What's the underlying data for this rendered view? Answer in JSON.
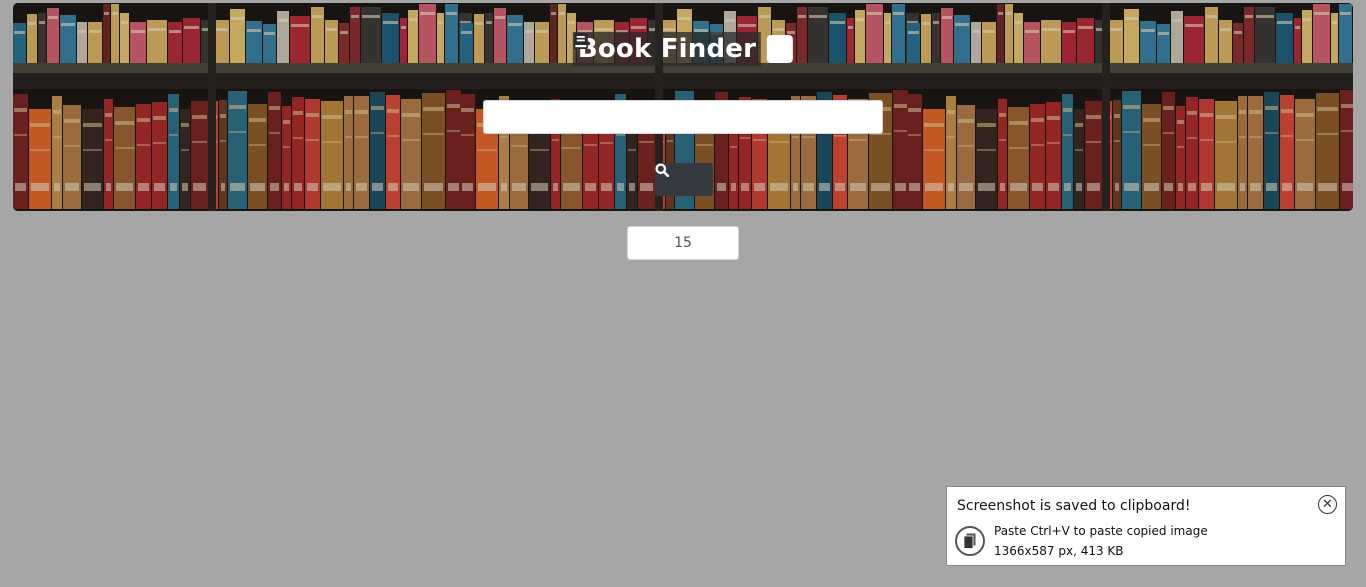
{
  "header": {
    "title": "Book Finder",
    "title_icon": "book-icon"
  },
  "search": {
    "value": "",
    "placeholder": "",
    "button_icon": "search-icon"
  },
  "results_count": {
    "value": "15"
  },
  "toast": {
    "title": "Screenshot is saved to clipboard!",
    "line1": "Paste Ctrl+V to paste copied image",
    "line2": "1366x587 px, 413 KB",
    "close_icon": "close-icon",
    "image_icon": "clipboard-icon"
  },
  "colors": {
    "page_background": "#a6a6a6",
    "search_button": "#343a40",
    "title_text": "#ffffff"
  }
}
